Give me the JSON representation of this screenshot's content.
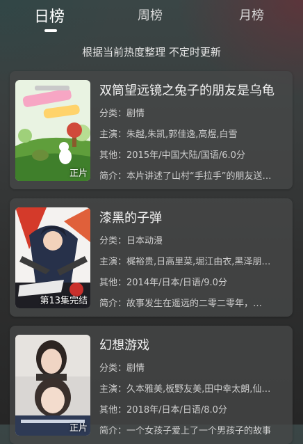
{
  "tabs": [
    {
      "label": "日榜",
      "active": true
    },
    {
      "label": "周榜",
      "active": false
    },
    {
      "label": "月榜",
      "active": false
    }
  ],
  "subtitle": "根据当前热度整理 不定时更新",
  "items": [
    {
      "title": "双筒望远镜之兔子的朋友是乌龟",
      "genre": "分类：剧情",
      "cast": "主演：朱越,朱凯,郭佳逸,高煜,白雪",
      "other": "其他：2015年/中国大陆/国语/6.0分",
      "summary": "简介：本片讲述了山村“手拉手”的朋友送…",
      "status": "正片"
    },
    {
      "title": "漆黑的子弹",
      "genre": "分类：日本动漫",
      "cast": "主演：梶裕贵,日高里菜,堀江由衣,黑泽朋…",
      "other": "其他：2014年/日本/日语/9.0分",
      "summary": "简介：故事发生在遥远的二零二零年，…",
      "status": "第13集完结"
    },
    {
      "title": "幻想游戏",
      "genre": "分类：剧情",
      "cast": "主演：久本雅美,板野友美,田中幸太朗,仙…",
      "other": "其他：2018年/日本/日语/8.0分",
      "summary": "简介：一个女孩子爱上了一个男孩子的故事",
      "status": "正片"
    }
  ]
}
